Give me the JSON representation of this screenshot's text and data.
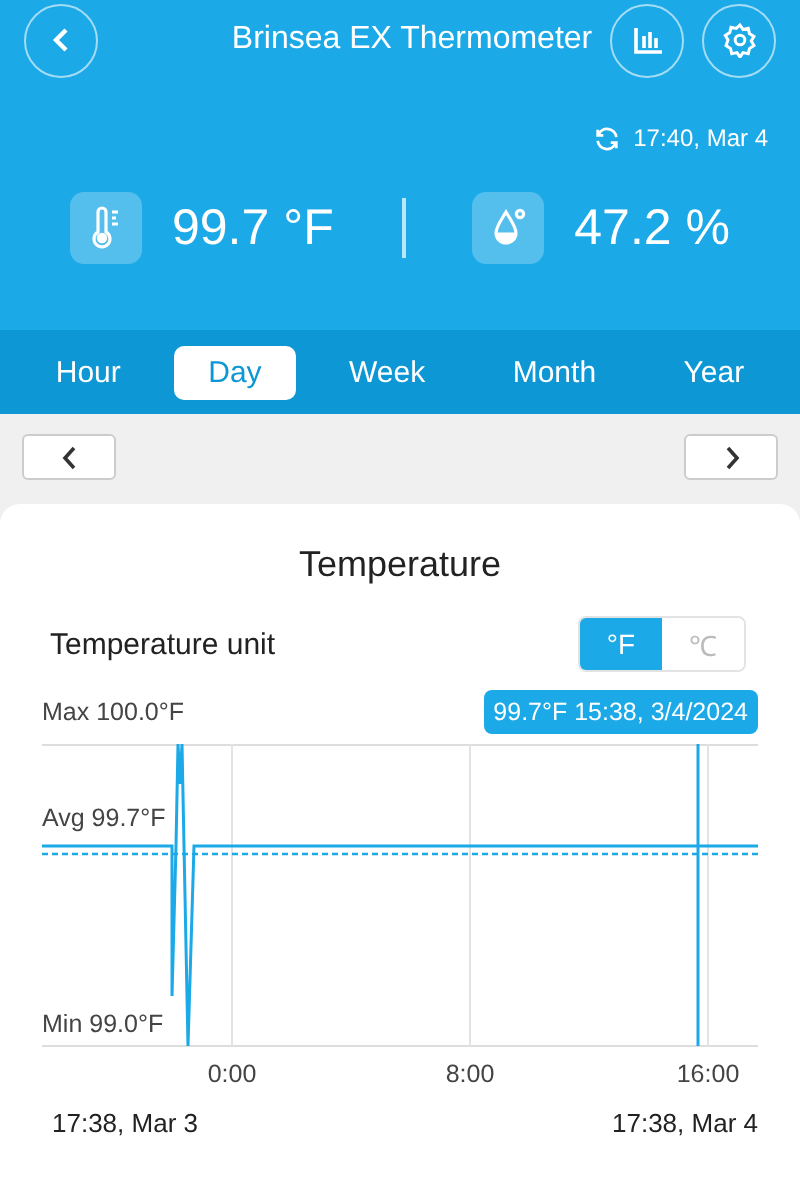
{
  "header": {
    "title": "Brinsea EX Thermometer",
    "sync_time": "17:40, Mar 4"
  },
  "readings": [
    {
      "kind": "temperature",
      "value": "99.7 °F"
    },
    {
      "kind": "humidity",
      "value": "47.2 %"
    }
  ],
  "tabs": [
    {
      "label": "Hour",
      "selected": false
    },
    {
      "label": "Day",
      "selected": true
    },
    {
      "label": "Week",
      "selected": false
    },
    {
      "label": "Month",
      "selected": false
    },
    {
      "label": "Year",
      "selected": false
    }
  ],
  "chart": {
    "title": "Temperature",
    "unit_label": "Temperature unit",
    "units": [
      {
        "label": "°F",
        "selected": true
      },
      {
        "label": "℃",
        "selected": false
      }
    ],
    "max_label": "Max 100.0°F",
    "avg_label": "Avg 99.7°F",
    "min_label": "Min 99.0°F",
    "tooltip": "99.7°F 15:38, 3/4/2024",
    "x_ticks": [
      "0:00",
      "8:00",
      "16:00"
    ],
    "start": "17:38, Mar 3",
    "end": "17:38, Mar 4"
  }
}
